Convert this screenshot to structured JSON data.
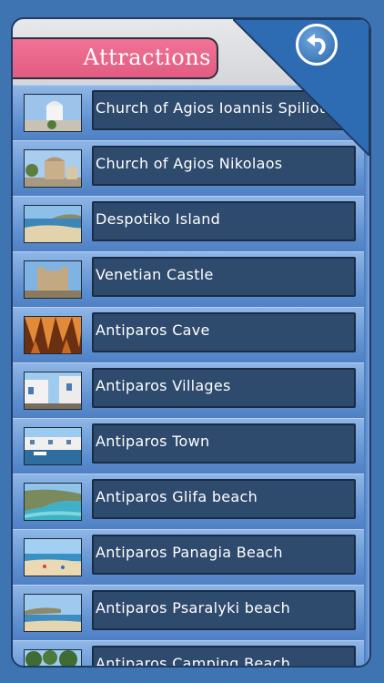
{
  "header": {
    "title": "Attractions",
    "back_icon": "back-arrow-icon"
  },
  "colors": {
    "background": "#3f74b3",
    "title_tab": "#e9668c",
    "label_box": "#2e4a6d",
    "corner": "#2d6bb3"
  },
  "attractions": [
    {
      "label": "Church of Agios Ioannis Spiliotis",
      "thumb": "white-chapel-photo"
    },
    {
      "label": "Church of Agios Nikolaos",
      "thumb": "stone-church-photo"
    },
    {
      "label": "Despotiko Island",
      "thumb": "island-beach-photo"
    },
    {
      "label": "Venetian Castle",
      "thumb": "castle-ruins-photo"
    },
    {
      "label": "Antiparos Cave",
      "thumb": "stalactite-cave-photo"
    },
    {
      "label": "Antiparos Villages",
      "thumb": "village-street-photo"
    },
    {
      "label": "Antiparos Town",
      "thumb": "harbor-town-photo"
    },
    {
      "label": "Antiparos Glifa beach",
      "thumb": "turquoise-bay-photo"
    },
    {
      "label": "Antiparos Panagia Beach",
      "thumb": "sandy-beach-photo"
    },
    {
      "label": "Antiparos Psaralyki beach",
      "thumb": "shore-beach-photo"
    },
    {
      "label": "Antiparos Camping Beach",
      "thumb": "trees-beach-photo"
    }
  ]
}
